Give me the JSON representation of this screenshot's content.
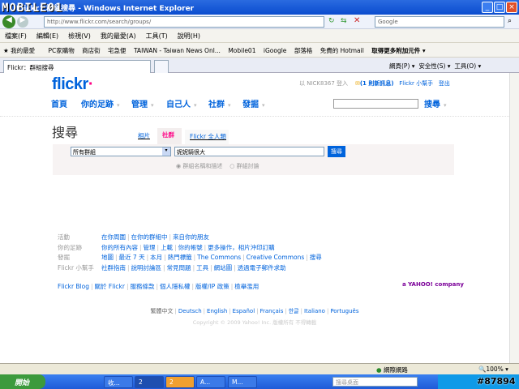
{
  "window": {
    "title": "Flickr：群組搜尋 - Windows Internet Explorer",
    "watermark": "MOBILE01"
  },
  "address": {
    "url": "http://www.flickr.com/search/groups/",
    "search_placeholder": "Google"
  },
  "menu": [
    "檔案(F)",
    "編輯(E)",
    "檢視(V)",
    "我的最愛(A)",
    "工具(T)",
    "說明(H)"
  ],
  "favorites": [
    "我的最愛",
    "PC家購物",
    "商店街",
    "宅急便",
    "TAIWAN - Taiwan News Onl...",
    "Mobile01",
    "iGoogle",
    "部落格",
    "免費的 Hotmail",
    "取得更多附加元件 ▾"
  ],
  "tab": {
    "label": "Flickr：群組搜尋"
  },
  "toolbar": {
    "page": "網頁(P) ▾",
    "safety": "安全性(S) ▾",
    "tools": "工具(O) ▾"
  },
  "flickr": {
    "logo": "flickr",
    "user": "以 NICK8367 登入",
    "messages": "(1 則新訊息)",
    "help": "Flickr 小幫手",
    "logout": "登出",
    "nav": [
      "首頁",
      "你的足跡",
      "管理",
      "自己人",
      "社群",
      "發掘"
    ],
    "nav_search": "搜尋",
    "page_title": "搜尋",
    "search_tabs": [
      "相片",
      "社群",
      "Flickr 全人類"
    ],
    "scope": "所有群組",
    "query": "妮妮騎很大",
    "search_btn": "搜尋",
    "radio": [
      "群組名稱和描述",
      "群組討論"
    ]
  },
  "footer": {
    "rows": [
      {
        "label": "活動",
        "links": [
          "在你周圍",
          "在你的群組中",
          "來自你的朋友"
        ]
      },
      {
        "label": "你的足跡",
        "links": [
          "你的所有內容",
          "管理",
          "上載",
          "你的帳號",
          "更多操作，相片沖印訂購"
        ]
      },
      {
        "label": "發掘",
        "links": [
          "地圖",
          "最近 7 天",
          "本月",
          "熱門標籤",
          "The Commons",
          "Creative Commons",
          "搜尋"
        ]
      },
      {
        "label": "Flickr 小幫手",
        "links": [
          "社群指南",
          "說明討論區",
          "常見問題",
          "工具",
          "網站圖",
          "透過電子郵件求助"
        ]
      }
    ],
    "blog_links": [
      "Flickr Blog",
      "關於 Flickr",
      "服務條款",
      "個人隱私權",
      "版權/IP 政策",
      "檢舉濫用"
    ],
    "yahoo": "a YAHOO! company",
    "languages": [
      "繁體中文",
      "Deutsch",
      "English",
      "Español",
      "Français",
      "한글",
      "Italiano",
      "Português"
    ],
    "copyright": "Copyright © 2009 Yahoo! Inc. 版權所有 不得轉載"
  },
  "status": {
    "zone": "網際網路",
    "zoom": "100%"
  },
  "taskbar": {
    "start": "開始",
    "items": [
      "收...",
      "2",
      "2",
      "A...",
      "M..."
    ],
    "search_placeholder": "搜尋桌面",
    "tag": "#87894"
  }
}
